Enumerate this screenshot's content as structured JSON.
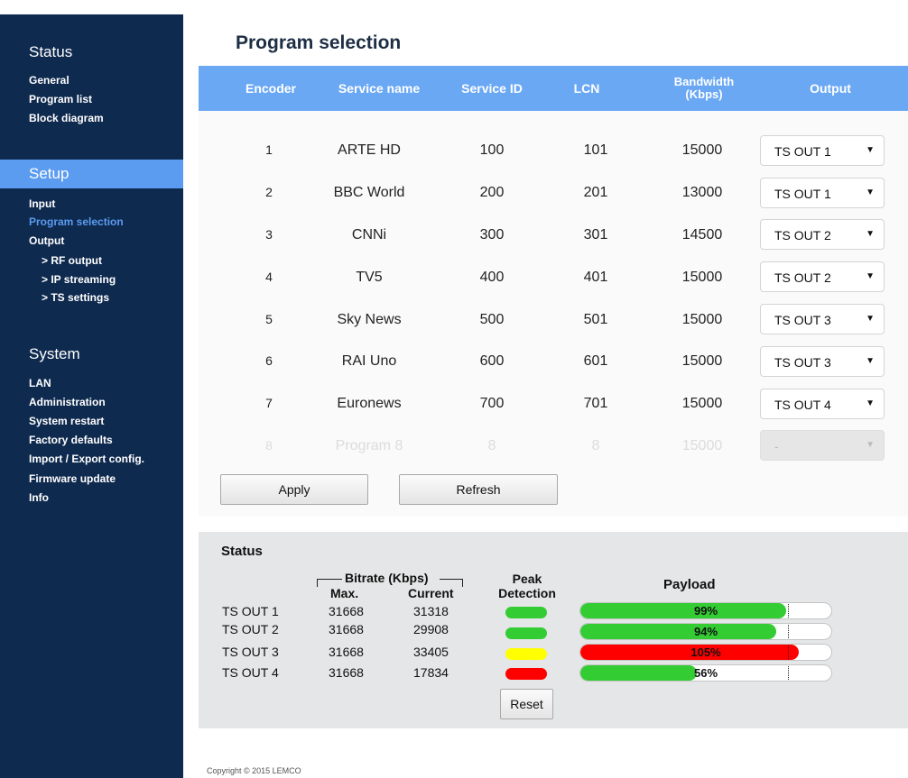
{
  "sidebar": {
    "status": {
      "title": "Status",
      "items": [
        "General",
        "Program list",
        "Block diagram"
      ]
    },
    "setup": {
      "title": "Setup",
      "items": [
        "Input",
        "Program selection",
        "Output"
      ],
      "sub_items": [
        "> RF output",
        "> IP streaming",
        "> TS settings"
      ]
    },
    "system": {
      "title": "System",
      "items": [
        "LAN",
        "Administration",
        "System restart",
        "Factory defaults",
        "Import / Export config.",
        "Firmware update",
        "Info"
      ]
    }
  },
  "page": {
    "title": "Program selection"
  },
  "table": {
    "headers": {
      "encoder": "Encoder",
      "service_name": "Service name",
      "service_id": "Service ID",
      "lcn": "LCN",
      "bandwidth_1": "Bandwidth",
      "bandwidth_2": "(Kbps)",
      "output": "Output"
    },
    "rows": [
      {
        "encoder": "1",
        "service_name": "ARTE HD",
        "service_id": "100",
        "lcn": "101",
        "bandwidth": "15000",
        "output": "TS OUT 1"
      },
      {
        "encoder": "2",
        "service_name": "BBC World",
        "service_id": "200",
        "lcn": "201",
        "bandwidth": "13000",
        "output": "TS OUT 1"
      },
      {
        "encoder": "3",
        "service_name": "CNNi",
        "service_id": "300",
        "lcn": "301",
        "bandwidth": "14500",
        "output": "TS OUT 2"
      },
      {
        "encoder": "4",
        "service_name": "TV5",
        "service_id": "400",
        "lcn": "401",
        "bandwidth": "15000",
        "output": "TS OUT 2"
      },
      {
        "encoder": "5",
        "service_name": "Sky News",
        "service_id": "500",
        "lcn": "501",
        "bandwidth": "15000",
        "output": "TS OUT 3"
      },
      {
        "encoder": "6",
        "service_name": "RAI Uno",
        "service_id": "600",
        "lcn": "601",
        "bandwidth": "15000",
        "output": "TS OUT 3"
      },
      {
        "encoder": "7",
        "service_name": "Euronews",
        "service_id": "700",
        "lcn": "701",
        "bandwidth": "15000",
        "output": "TS OUT 4"
      },
      {
        "encoder": "8",
        "service_name": "Program 8",
        "service_id": "8",
        "lcn": "8",
        "bandwidth": "15000",
        "output": "-",
        "disabled": true
      }
    ]
  },
  "buttons": {
    "apply": "Apply",
    "refresh": "Refresh"
  },
  "status": {
    "title": "Status",
    "bitrate_header": "Bitrate (Kbps)",
    "max_label": "Max.",
    "current_label": "Current",
    "peak_label_1": "Peak",
    "peak_label_2": "Detection",
    "payload_label": "Payload",
    "reset": "Reset",
    "rows": [
      {
        "name": "TS OUT 1",
        "max": "31668",
        "current": "31318",
        "peak_color": "#33cc33",
        "payload": "99%",
        "payload_value": 99,
        "bar_color": "#33cc33"
      },
      {
        "name": "TS OUT 2",
        "max": "31668",
        "current": "29908",
        "peak_color": "#33cc33",
        "payload": "94%",
        "payload_value": 94,
        "bar_color": "#33cc33"
      },
      {
        "name": "TS OUT 3",
        "max": "31668",
        "current": "33405",
        "peak_color": "#ffff00",
        "payload": "105%",
        "payload_value": 105,
        "bar_color": "#ff0000"
      },
      {
        "name": "TS OUT 4",
        "max": "31668",
        "current": "17834",
        "peak_color": "#ff0000",
        "payload": "56%",
        "payload_value": 56,
        "bar_color": "#33cc33"
      }
    ]
  },
  "footer": {
    "copyright": "Copyright © 2015 LEMCO"
  }
}
